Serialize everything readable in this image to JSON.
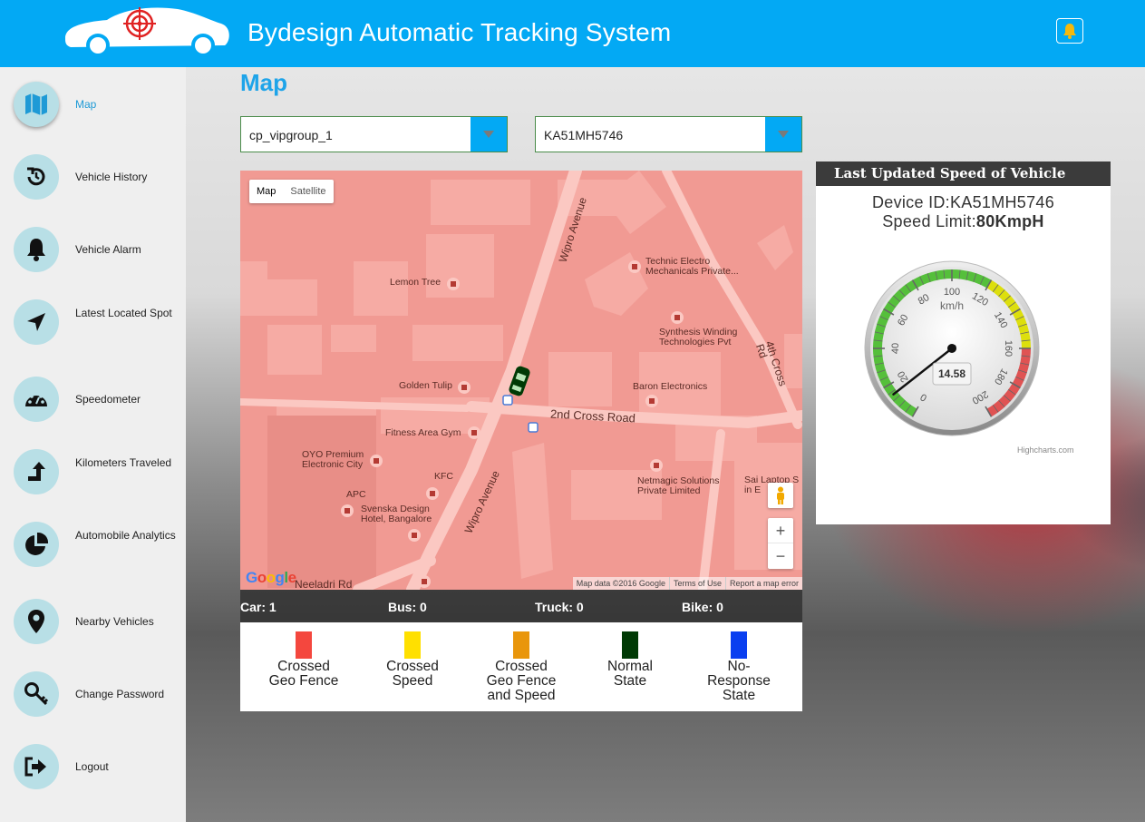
{
  "header": {
    "title": "Bydesign Automatic Tracking System",
    "brand_color": "#03a9f4",
    "notification_icon": "bell-icon"
  },
  "sidebar": {
    "items": [
      {
        "label": "Map",
        "icon": "map-icon",
        "active": true
      },
      {
        "label": "Vehicle History",
        "icon": "history-icon"
      },
      {
        "label": "Vehicle Alarm",
        "icon": "bell-icon"
      },
      {
        "label": "Latest Located Spot",
        "icon": "location-arrow-icon"
      },
      {
        "label": "Speedometer",
        "icon": "speedometer-icon"
      },
      {
        "label": "Kilometers Traveled",
        "icon": "turn-up-arrow-icon"
      },
      {
        "label": "Automobile Analytics",
        "icon": "pie-chart-icon"
      },
      {
        "label": "Nearby Vehicles",
        "icon": "map-marker-icon"
      },
      {
        "label": "Change Password",
        "icon": "key-icon"
      },
      {
        "label": "Logout",
        "icon": "logout-icon"
      }
    ]
  },
  "main": {
    "page_title": "Map",
    "group_select": {
      "value": "cp_vipgroup_1"
    },
    "vehicle_select": {
      "value": "KA51MH5746"
    }
  },
  "map": {
    "type_buttons": [
      "Map",
      "Satellite"
    ],
    "zoom_in": "+",
    "zoom_out": "−",
    "footer": [
      "Map data ©2016 Google",
      "Terms of Use",
      "Report a map error"
    ],
    "google_logo": "Google",
    "labels": {
      "wipro_avenue_top": "Wipro Avenue",
      "wipro_avenue_bottom": "Wipro Avenue",
      "second_cross": "2nd Cross Road",
      "fourth_cross": "4th Cross Rd",
      "lemon_tree": "Lemon Tree",
      "technic": "Technic Electro Mechanicals Private...",
      "synthesis": "Synthesis Winding Technologies Pvt",
      "golden_tulip": "Golden Tulip",
      "baron": "Baron Electronics",
      "fitness": "Fitness Area Gym",
      "oyo": "OYO Premium Electronic City",
      "kfc": "KFC",
      "apc": "APC",
      "svenska": "Svenska Design Hotel, Bangalore",
      "netmagic": "Netmagic Solutions Private Limited",
      "sai_laptop": "Sai Laptop S\nin E",
      "neeladri": "Neeladri Rd"
    }
  },
  "counts": {
    "car": "Car: 1",
    "bus": "Bus: 0",
    "truck": "Truck: 0",
    "bike": "Bike: 0"
  },
  "legend": [
    {
      "label": "Crossed Geo Fence",
      "color": "#f4473e"
    },
    {
      "label": "Crossed Speed",
      "color": "#ffe000"
    },
    {
      "label": "Crossed Geo Fence and Speed",
      "color": "#e9960b"
    },
    {
      "label": "Normal State",
      "color": "#003a05"
    },
    {
      "label": "No-Response State",
      "color": "#0a3ff0"
    }
  ],
  "speed_panel": {
    "title": "Last Updated Speed of Vehicle",
    "device_id": "Device ID:KA51MH5746",
    "speed_limit_label": "Speed Limit:",
    "speed_limit_value": "80KmpH",
    "credits": "Highcharts.com"
  },
  "chart_data": {
    "type": "gauge",
    "unit": "km/h",
    "value": 14.58,
    "min": 0,
    "max": 200,
    "tick_labels": [
      "0",
      "20",
      "40",
      "60",
      "80",
      "100",
      "120",
      "140",
      "160",
      "180",
      "200"
    ],
    "bands": [
      {
        "from": 0,
        "to": 120,
        "color": "#55bf3b"
      },
      {
        "from": 120,
        "to": 160,
        "color": "#dddf0d"
      },
      {
        "from": 160,
        "to": 200,
        "color": "#df5353"
      }
    ],
    "value_label": "14.58"
  }
}
